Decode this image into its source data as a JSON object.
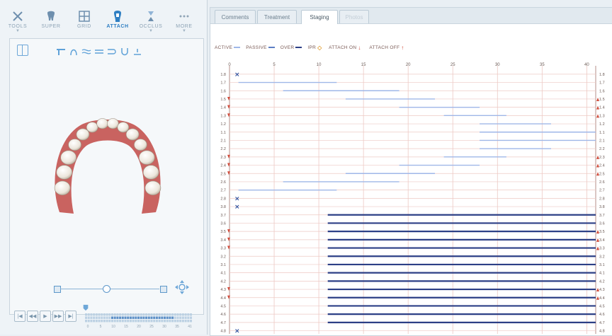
{
  "toolbar": {
    "tools": [
      {
        "id": "tools",
        "label": "TOOLS",
        "icon": "wrench-icon",
        "active": false,
        "has_menu": true
      },
      {
        "id": "super",
        "label": "SUPER",
        "icon": "tooth-icon",
        "active": false,
        "has_menu": false
      },
      {
        "id": "grid",
        "label": "GRID",
        "icon": "grid-icon",
        "active": false,
        "has_menu": false
      },
      {
        "id": "attach",
        "label": "ATTACH",
        "icon": "attachment-icon",
        "active": true,
        "has_menu": false
      },
      {
        "id": "occlus",
        "label": "OCCLUS",
        "icon": "occlusion-icon",
        "active": false,
        "has_menu": true
      },
      {
        "id": "more",
        "label": "MORE",
        "icon": "more-icon",
        "active": false,
        "has_menu": true
      }
    ]
  },
  "viewport": {
    "view_icon": "split-view-icon",
    "subtools": [
      "attachment-rect-icon",
      "arch-icon",
      "curve-double-icon",
      "equals-icon",
      "bracket-icon",
      "u-shape-icon",
      "baseline-icon"
    ]
  },
  "playback": {
    "buttons": [
      "|◀",
      "◀◀",
      "▶",
      "▶▶",
      "▶|"
    ],
    "stage_ticks": [
      "0",
      "5",
      "10",
      "15",
      "20",
      "25",
      "30",
      "35",
      "41"
    ]
  },
  "tabs": [
    {
      "label": "Comments",
      "active": false,
      "disabled": false
    },
    {
      "label": "Treatment",
      "active": false,
      "disabled": false
    },
    {
      "label": "Staging",
      "active": true,
      "disabled": false
    },
    {
      "label": "Photos",
      "active": false,
      "disabled": true
    }
  ],
  "legend": [
    {
      "label": "ACTIVE",
      "marker": "line",
      "color": "#9fb7e8"
    },
    {
      "label": "PASSIVE",
      "marker": "line",
      "color": "#5d7fc4"
    },
    {
      "label": "OVER",
      "marker": "line",
      "color": "#2c3f86"
    },
    {
      "label": "IPR",
      "marker": "diamond",
      "color": "#e2a23b"
    },
    {
      "label": "ATTACH ON",
      "marker": "arrow-down",
      "color": "#d04a3a"
    },
    {
      "label": "ATTACH OFF",
      "marker": "arrow-up",
      "color": "#d04a3a"
    }
  ],
  "colors": {
    "active": "#9fb7e8",
    "passive": "#5d7fc4",
    "over": "#2c3f86",
    "grid": "#edc9c4",
    "attach": "#d04a3a",
    "missing": "#2c4f9e"
  },
  "chart_data": {
    "type": "table",
    "x_ticks": [
      "0",
      "5",
      "10",
      "15",
      "20",
      "25",
      "30",
      "35",
      "40"
    ],
    "xlim": [
      0,
      41
    ],
    "teeth": [
      {
        "id": "1.8",
        "attach_on": false,
        "missing": true,
        "segments": []
      },
      {
        "id": "1.7",
        "attach_on": false,
        "missing": false,
        "segments": [
          {
            "from": 1,
            "to": 12,
            "kind": "active"
          }
        ]
      },
      {
        "id": "1.6",
        "attach_on": false,
        "missing": false,
        "segments": [
          {
            "from": 6,
            "to": 19,
            "kind": "active"
          }
        ]
      },
      {
        "id": "1.5",
        "attach_on": true,
        "missing": false,
        "segments": [
          {
            "from": 13,
            "to": 23,
            "kind": "active"
          }
        ]
      },
      {
        "id": "1.4",
        "attach_on": true,
        "missing": false,
        "segments": [
          {
            "from": 19,
            "to": 28,
            "kind": "active"
          }
        ]
      },
      {
        "id": "1.3",
        "attach_on": true,
        "missing": false,
        "segments": [
          {
            "from": 24,
            "to": 31,
            "kind": "active"
          }
        ]
      },
      {
        "id": "1.2",
        "attach_on": false,
        "missing": false,
        "segments": [
          {
            "from": 28,
            "to": 36,
            "kind": "active"
          }
        ]
      },
      {
        "id": "1.1",
        "attach_on": false,
        "missing": false,
        "segments": [
          {
            "from": 28,
            "to": 41,
            "kind": "active"
          }
        ]
      },
      {
        "id": "2.1",
        "attach_on": false,
        "missing": false,
        "segments": [
          {
            "from": 28,
            "to": 41,
            "kind": "active"
          }
        ]
      },
      {
        "id": "2.2",
        "attach_on": false,
        "missing": false,
        "segments": [
          {
            "from": 28,
            "to": 36,
            "kind": "active"
          }
        ]
      },
      {
        "id": "2.3",
        "attach_on": true,
        "missing": false,
        "segments": [
          {
            "from": 24,
            "to": 31,
            "kind": "active"
          }
        ]
      },
      {
        "id": "2.4",
        "attach_on": true,
        "missing": false,
        "segments": [
          {
            "from": 19,
            "to": 28,
            "kind": "active"
          }
        ]
      },
      {
        "id": "2.5",
        "attach_on": true,
        "missing": false,
        "segments": [
          {
            "from": 13,
            "to": 23,
            "kind": "active"
          }
        ]
      },
      {
        "id": "2.6",
        "attach_on": false,
        "missing": false,
        "segments": [
          {
            "from": 6,
            "to": 19,
            "kind": "active"
          }
        ]
      },
      {
        "id": "2.7",
        "attach_on": false,
        "missing": false,
        "segments": [
          {
            "from": 1,
            "to": 12,
            "kind": "active"
          }
        ]
      },
      {
        "id": "2.8",
        "attach_on": false,
        "missing": true,
        "segments": []
      },
      {
        "id": "3.8",
        "attach_on": false,
        "missing": true,
        "segments": []
      },
      {
        "id": "3.7",
        "attach_on": false,
        "missing": false,
        "segments": [
          {
            "from": 11,
            "to": 41,
            "kind": "over"
          }
        ]
      },
      {
        "id": "3.6",
        "attach_on": false,
        "missing": false,
        "segments": [
          {
            "from": 11,
            "to": 41,
            "kind": "over"
          }
        ]
      },
      {
        "id": "3.5",
        "attach_on": true,
        "missing": false,
        "segments": [
          {
            "from": 11,
            "to": 41,
            "kind": "over"
          }
        ]
      },
      {
        "id": "3.4",
        "attach_on": true,
        "missing": false,
        "segments": [
          {
            "from": 11,
            "to": 41,
            "kind": "over"
          }
        ]
      },
      {
        "id": "3.3",
        "attach_on": true,
        "missing": false,
        "segments": [
          {
            "from": 11,
            "to": 41,
            "kind": "over"
          }
        ]
      },
      {
        "id": "3.2",
        "attach_on": false,
        "missing": false,
        "segments": [
          {
            "from": 11,
            "to": 41,
            "kind": "over"
          }
        ]
      },
      {
        "id": "3.1",
        "attach_on": false,
        "missing": false,
        "segments": [
          {
            "from": 11,
            "to": 41,
            "kind": "over"
          }
        ]
      },
      {
        "id": "4.1",
        "attach_on": false,
        "missing": false,
        "segments": [
          {
            "from": 11,
            "to": 41,
            "kind": "over"
          }
        ]
      },
      {
        "id": "4.2",
        "attach_on": false,
        "missing": false,
        "segments": [
          {
            "from": 11,
            "to": 41,
            "kind": "over"
          }
        ]
      },
      {
        "id": "4.3",
        "attach_on": true,
        "missing": false,
        "segments": [
          {
            "from": 11,
            "to": 41,
            "kind": "over"
          }
        ]
      },
      {
        "id": "4.4",
        "attach_on": true,
        "missing": false,
        "segments": [
          {
            "from": 11,
            "to": 41,
            "kind": "over"
          }
        ]
      },
      {
        "id": "4.5",
        "attach_on": false,
        "missing": false,
        "segments": [
          {
            "from": 11,
            "to": 41,
            "kind": "over"
          }
        ]
      },
      {
        "id": "4.6",
        "attach_on": false,
        "missing": false,
        "segments": [
          {
            "from": 11,
            "to": 41,
            "kind": "over"
          }
        ]
      },
      {
        "id": "4.7",
        "attach_on": false,
        "missing": false,
        "segments": [
          {
            "from": 11,
            "to": 41,
            "kind": "over"
          }
        ]
      },
      {
        "id": "4.8",
        "attach_on": false,
        "missing": true,
        "segments": []
      }
    ]
  }
}
